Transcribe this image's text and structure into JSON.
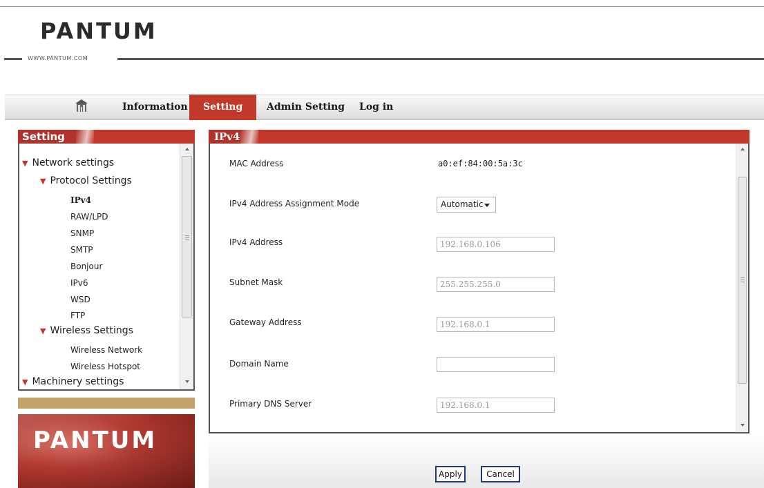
{
  "brand": {
    "logo_text": "PANTUM",
    "url_text": "WWW.PANTUM.COM",
    "panel_logo_text": "PANTUM"
  },
  "nav": {
    "home_icon": "home-icon",
    "items": [
      {
        "label": "Information",
        "active": false
      },
      {
        "label": "Setting",
        "active": true
      },
      {
        "label": "Admin Setting",
        "active": false
      },
      {
        "label": "Log in",
        "active": false
      }
    ]
  },
  "sidebar": {
    "title": "Setting",
    "tree": [
      {
        "label": "Network settings",
        "level": 0,
        "expanded": true
      },
      {
        "label": "Protocol Settings",
        "level": 1,
        "expanded": true
      },
      {
        "label": "IPv4",
        "level": 2,
        "active": true
      },
      {
        "label": "RAW/LPD",
        "level": 2
      },
      {
        "label": "SNMP",
        "level": 2
      },
      {
        "label": "SMTP",
        "level": 2
      },
      {
        "label": "Bonjour",
        "level": 2
      },
      {
        "label": "IPv6",
        "level": 2
      },
      {
        "label": "WSD",
        "level": 2
      },
      {
        "label": "FTP",
        "level": 2
      },
      {
        "label": "Wireless Settings",
        "level": 1,
        "expanded": true
      },
      {
        "label": "Wireless Network",
        "level": 2
      },
      {
        "label": "Wireless Hotspot",
        "level": 2
      },
      {
        "label": "Machinery settings",
        "level": 0,
        "expanded": true
      }
    ]
  },
  "main": {
    "title": "IPv4",
    "fields": {
      "mac": {
        "label": "MAC Address",
        "value": "a0:ef:84:00:5a:3c"
      },
      "mode": {
        "label": "IPv4 Address Assignment Mode",
        "value": "Automatic"
      },
      "ipv4": {
        "label": "IPv4 Address",
        "value": "192.168.0.106"
      },
      "subnet": {
        "label": "Subnet Mask",
        "value": "255.255.255.0"
      },
      "gateway": {
        "label": "Gateway Address",
        "value": "192.168.0.1"
      },
      "domain": {
        "label": "Domain Name",
        "value": ""
      },
      "dns": {
        "label": "Primary DNS Server",
        "value": "192.168.0.1"
      }
    }
  },
  "actions": {
    "apply": "Apply",
    "cancel": "Cancel"
  },
  "colors": {
    "accent": "#c0392b",
    "tan": "#c2a46b",
    "button_border": "#1e3a7a"
  }
}
